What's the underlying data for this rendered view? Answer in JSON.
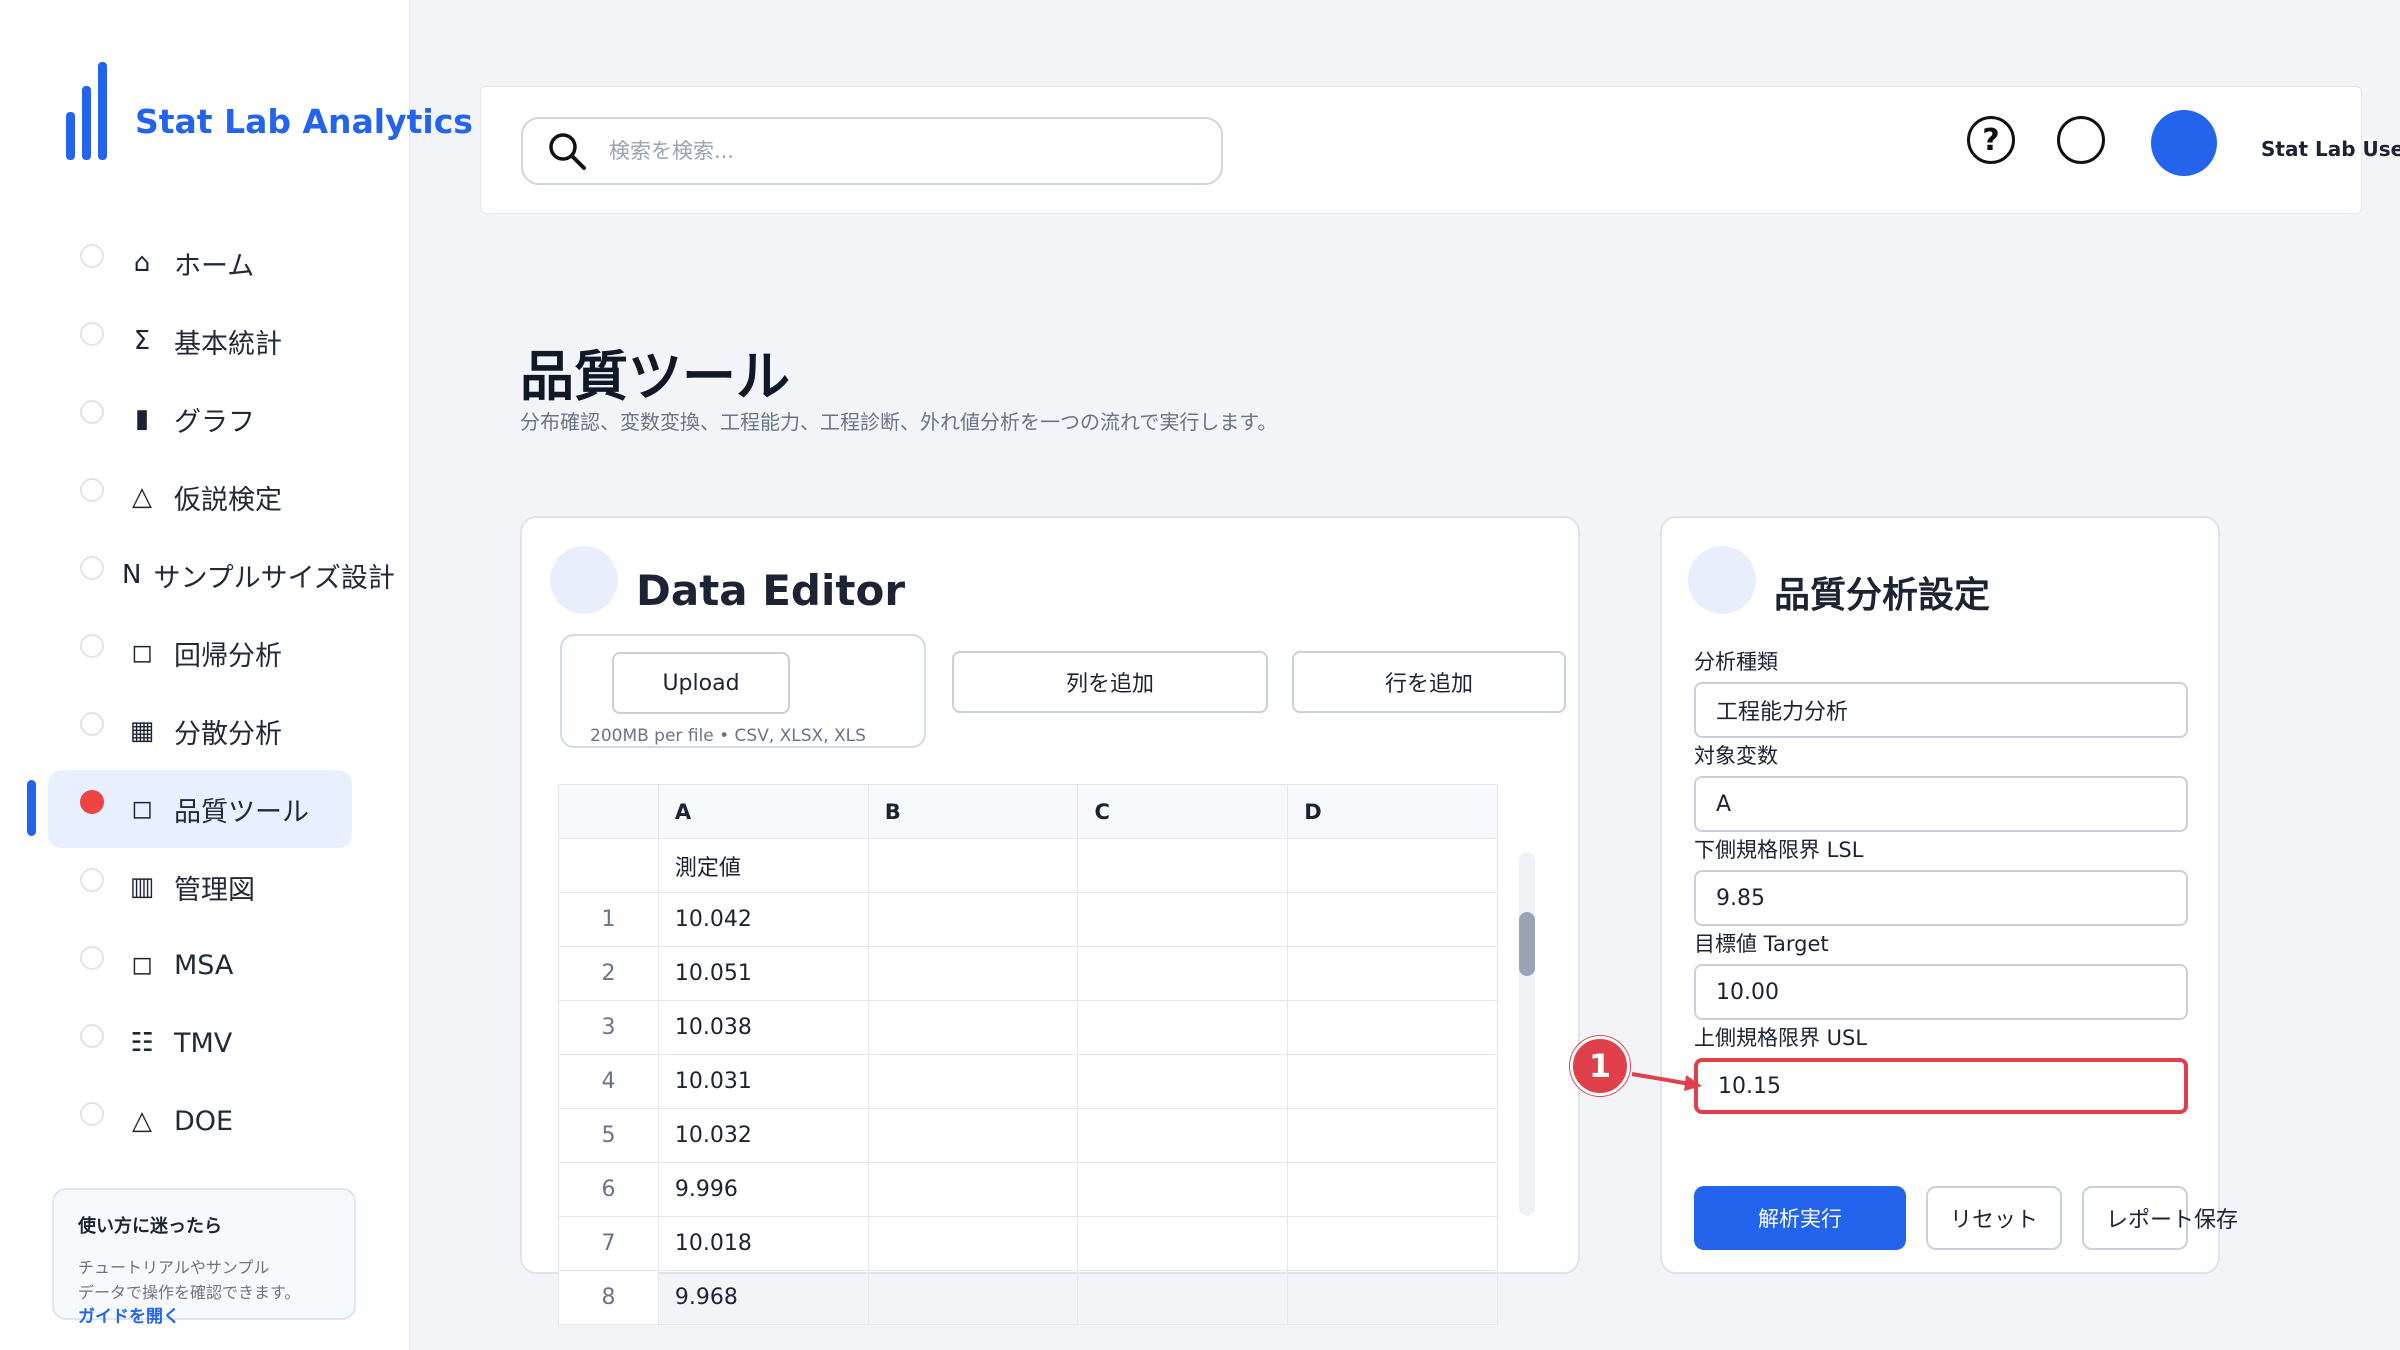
{
  "brand": {
    "name": "Stat Lab Analytics"
  },
  "sidebar": {
    "items": [
      {
        "icon": "⌂",
        "label": "ホーム"
      },
      {
        "icon": "Σ",
        "label": "基本統計"
      },
      {
        "icon": "▮",
        "label": "グラフ"
      },
      {
        "icon": "△",
        "label": "仮説検定"
      },
      {
        "icon": "N",
        "label": "サンプルサイズ設計"
      },
      {
        "icon": "◻",
        "label": "回帰分析"
      },
      {
        "icon": "▦",
        "label": "分散分析"
      },
      {
        "icon": "◻",
        "label": "品質ツール"
      },
      {
        "icon": "▥",
        "label": "管理図"
      },
      {
        "icon": "◻",
        "label": "MSA"
      },
      {
        "icon": "☷",
        "label": "TMV"
      },
      {
        "icon": "△",
        "label": "DOE"
      }
    ],
    "active_index": 7
  },
  "help_card": {
    "title": "使い方に迷ったら",
    "text_line1": "チュートリアルやサンプル",
    "text_line2": "データで操作を確認できます。",
    "link": "ガイドを開く"
  },
  "topbar": {
    "search_placeholder": "検索を検索...",
    "help_symbol": "?",
    "user_name": "Stat Lab User"
  },
  "page": {
    "title": "品質ツール",
    "subtitle": "分布確認、変数変換、工程能力、工程診断、外れ値分析を一つの流れで実行します。"
  },
  "editor": {
    "title": "Data Editor",
    "upload_label": "Upload",
    "upload_hint": "200MB per file • CSV, XLSX, XLS",
    "add_column_label": "列を追加",
    "add_row_label": "行を追加",
    "columns": [
      "A",
      "B",
      "C",
      "D"
    ],
    "header_row": [
      "測定値",
      "",
      "",
      ""
    ],
    "rows": [
      {
        "idx": "1",
        "cells": [
          "10.042",
          "",
          "",
          ""
        ]
      },
      {
        "idx": "2",
        "cells": [
          "10.051",
          "",
          "",
          ""
        ]
      },
      {
        "idx": "3",
        "cells": [
          "10.038",
          "",
          "",
          ""
        ]
      },
      {
        "idx": "4",
        "cells": [
          "10.031",
          "",
          "",
          ""
        ]
      },
      {
        "idx": "5",
        "cells": [
          "10.032",
          "",
          "",
          ""
        ]
      },
      {
        "idx": "6",
        "cells": [
          "9.996",
          "",
          "",
          ""
        ]
      },
      {
        "idx": "7",
        "cells": [
          "10.018",
          "",
          "",
          ""
        ]
      },
      {
        "idx": "8",
        "cells": [
          "9.968",
          "",
          "",
          ""
        ]
      }
    ]
  },
  "settings": {
    "title": "品質分析設定",
    "analysis_type_label": "分析種類",
    "analysis_type_value": "工程能力分析",
    "target_var_label": "対象変数",
    "target_var_value": "A",
    "lsl_label": "下側規格限界 LSL",
    "lsl_value": "9.85",
    "target_label": "目標値 Target",
    "target_value": "10.00",
    "usl_label": "上側規格限界 USL",
    "usl_value": "10.15",
    "run_label": "解析実行",
    "reset_label": "リセット",
    "report_label": "レポート保存"
  },
  "annotation": {
    "marker": "1"
  },
  "colors": {
    "accent": "#2463eb",
    "highlight": "#e0404a"
  }
}
